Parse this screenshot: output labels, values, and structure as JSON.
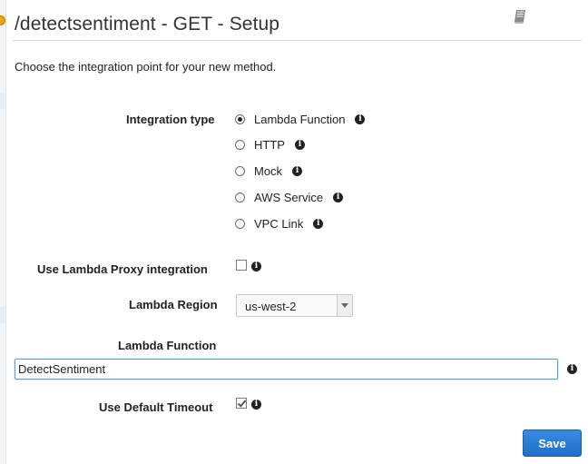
{
  "header": {
    "title": "/detectsentiment - GET - Setup",
    "help_icon": "book-icon"
  },
  "intro_text": "Choose the integration point for your new method.",
  "integration_type": {
    "label": "Integration type",
    "selected": "Lambda Function",
    "options": [
      {
        "label": "Lambda Function",
        "checked": true
      },
      {
        "label": "HTTP",
        "checked": false
      },
      {
        "label": "Mock",
        "checked": false
      },
      {
        "label": "AWS Service",
        "checked": false
      },
      {
        "label": "VPC Link",
        "checked": false
      }
    ]
  },
  "proxy": {
    "label": "Use Lambda Proxy integration",
    "checked": false
  },
  "region": {
    "label": "Lambda Region",
    "value": "us-west-2"
  },
  "function": {
    "label": "Lambda Function",
    "value": "DetectSentiment"
  },
  "timeout": {
    "label": "Use Default Timeout",
    "checked": true
  },
  "save_label": "Save",
  "colors": {
    "accent": "#1e6fcb",
    "focus_border": "#5b9dd9",
    "rail_indicator": "#f0a30a"
  }
}
